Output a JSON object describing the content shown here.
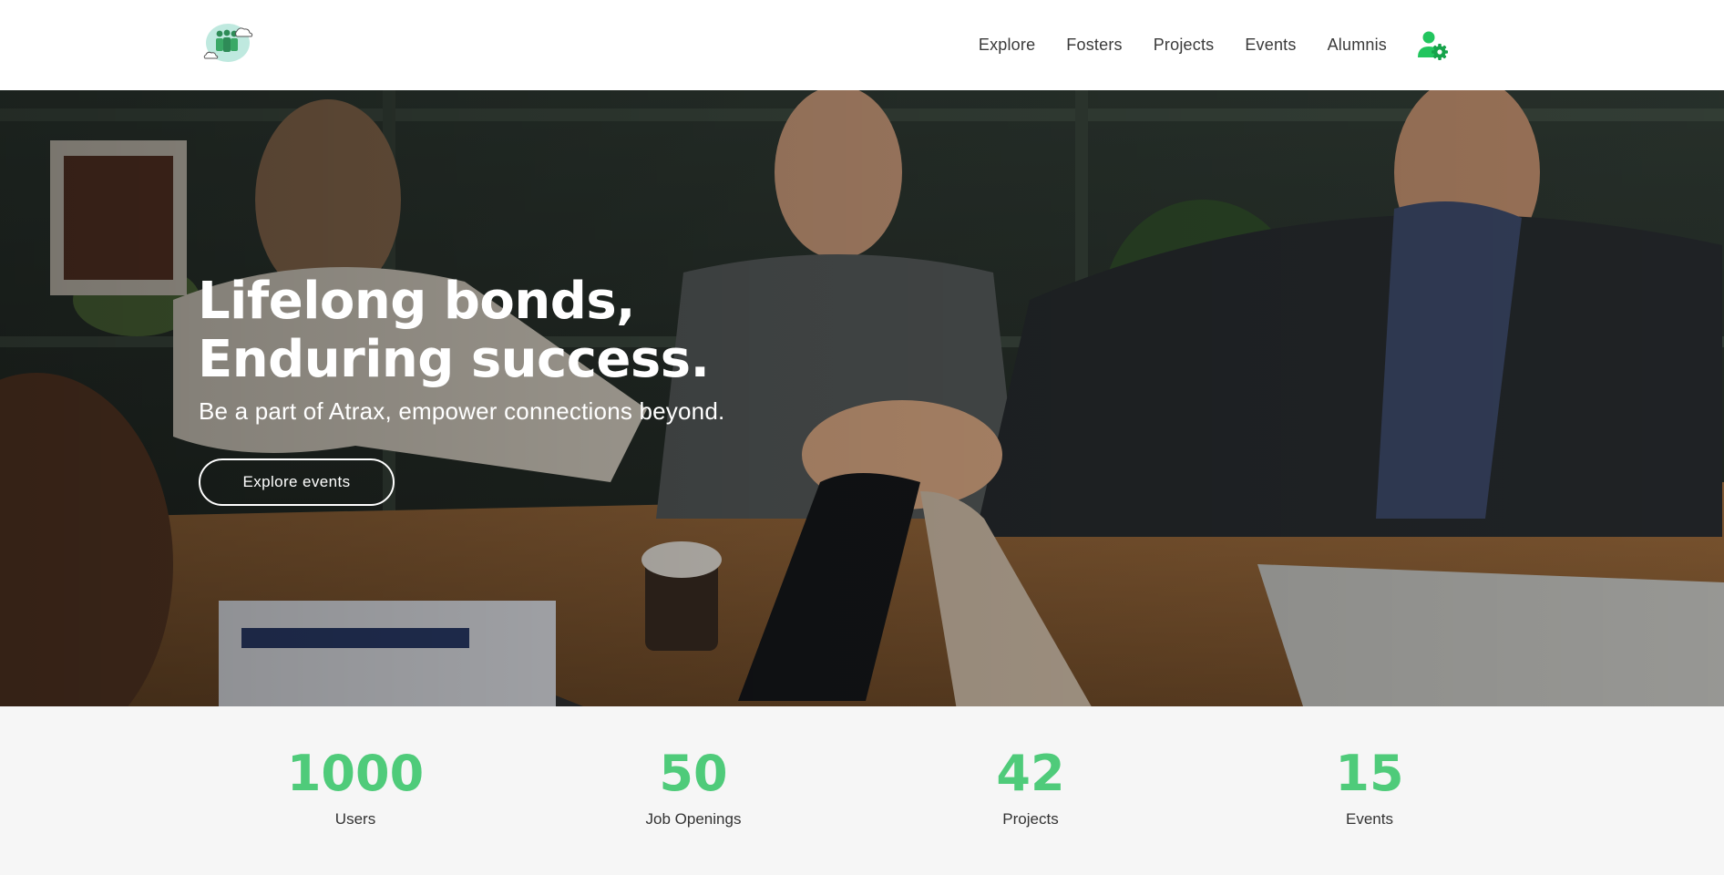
{
  "header": {
    "logo_icon": "team-cloud-logo-icon",
    "nav": [
      {
        "label": "Explore"
      },
      {
        "label": "Fosters"
      },
      {
        "label": "Projects"
      },
      {
        "label": "Events"
      },
      {
        "label": "Alumnis"
      }
    ],
    "user_settings_icon": "user-gear-icon"
  },
  "hero": {
    "title_line1": "Lifelong bonds,",
    "title_line2": "Enduring success.",
    "subtitle": "Be a part of Atrax, empower connections beyond.",
    "cta_label": "Explore events",
    "background": "team-hands-stack-photo"
  },
  "stats": [
    {
      "value": "1000",
      "label": "Users"
    },
    {
      "value": "50",
      "label": "Job Openings"
    },
    {
      "value": "42",
      "label": "Projects"
    },
    {
      "value": "15",
      "label": "Events"
    }
  ],
  "colors": {
    "accent": "#4fcb7a",
    "stats_bg": "#f6f6f6",
    "nav_text": "#3a3a3a"
  }
}
